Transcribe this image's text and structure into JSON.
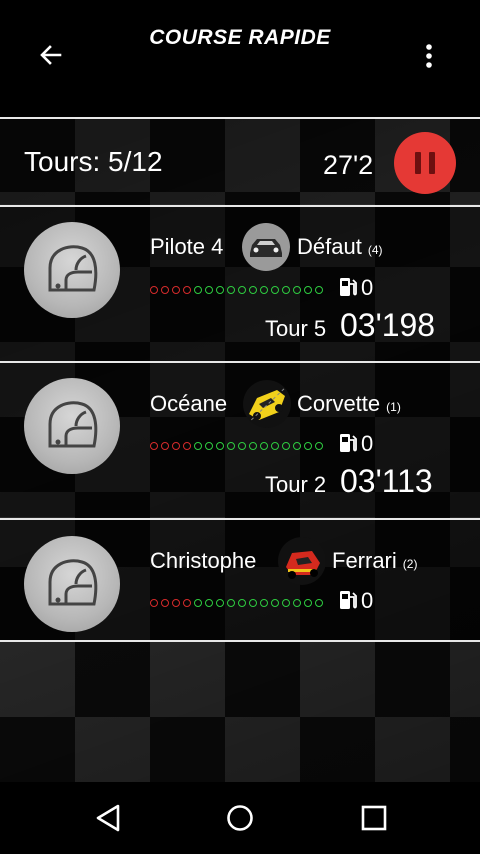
{
  "header": {
    "title": "COURSE RAPIDE",
    "back_icon": "arrow-left-icon",
    "menu_icon": "more-vert-icon"
  },
  "race": {
    "laps_text": "Tours: 5/12",
    "time": "27'2",
    "pause_icon": "pause-icon",
    "accent": "#e53935"
  },
  "pilots": [
    {
      "name": "Pilote 4",
      "car": "Défaut",
      "car_num": "(4)",
      "fuel": "0",
      "lap_label": "Tour 5",
      "lap_time": "03'198",
      "car_icon": "car-front-icon"
    },
    {
      "name": "Océane",
      "car": "Corvette",
      "car_num": "(1)",
      "fuel": "0",
      "lap_label": "Tour 2",
      "lap_time": "03'113",
      "car_icon": "corvette-car-icon"
    },
    {
      "name": "Christophe",
      "car": "Ferrari",
      "car_num": "(2)",
      "fuel": "0",
      "lap_label": "",
      "lap_time": "",
      "car_icon": "ferrari-car-icon"
    }
  ],
  "fuel_gauge": {
    "red_count": 4,
    "green_count": 12,
    "red": "#d62b2b",
    "green": "#2ecc40"
  },
  "navbar": {
    "back": "nav-back-icon",
    "home": "nav-home-icon",
    "recents": "nav-recents-icon"
  }
}
